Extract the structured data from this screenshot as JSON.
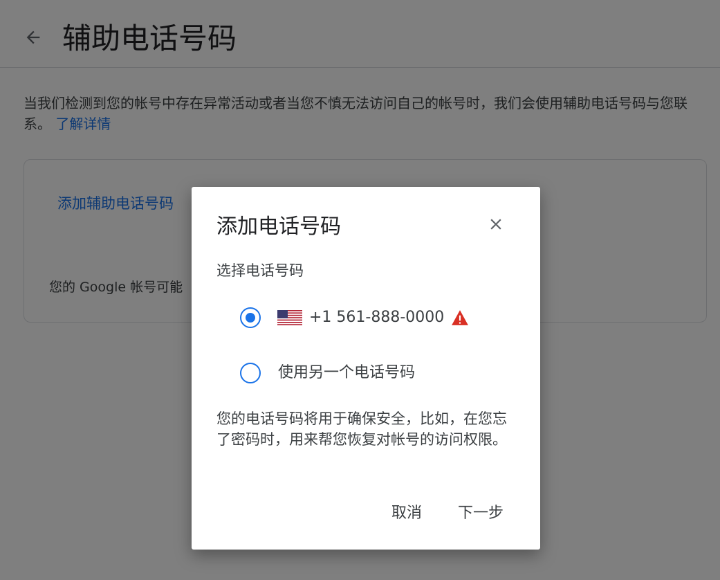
{
  "header": {
    "back_icon": "arrow-left-icon",
    "title": "辅助电话号码"
  },
  "intro": {
    "text": "当我们检测到您的帐号中存在异常活动或者当您不慎无法访问自己的帐号时，我们会使用辅助电话号码与您联系。",
    "learn_more": "了解详情"
  },
  "card": {
    "add_link": "添加辅助电话号码",
    "note": "您的 Google 帐号可能"
  },
  "dialog": {
    "title": "添加电话号码",
    "close_icon": "close-icon",
    "select_label": "选择电话号码",
    "options": [
      {
        "flag_icon": "us-flag-icon",
        "label": "+1 561-888-0000",
        "warning_icon": "warning-icon",
        "selected": true
      },
      {
        "label": "使用另一个电话号码",
        "selected": false
      }
    ],
    "description": "您的电话号码将用于确保安全，比如，在您忘了密码时，用来帮您恢复对帐号的访问权限。",
    "cancel_label": "取消",
    "next_label": "下一步"
  },
  "colors": {
    "accent": "#1a73e8",
    "warning": "#d93025",
    "scrim": "rgba(0,0,0,0.50)"
  }
}
